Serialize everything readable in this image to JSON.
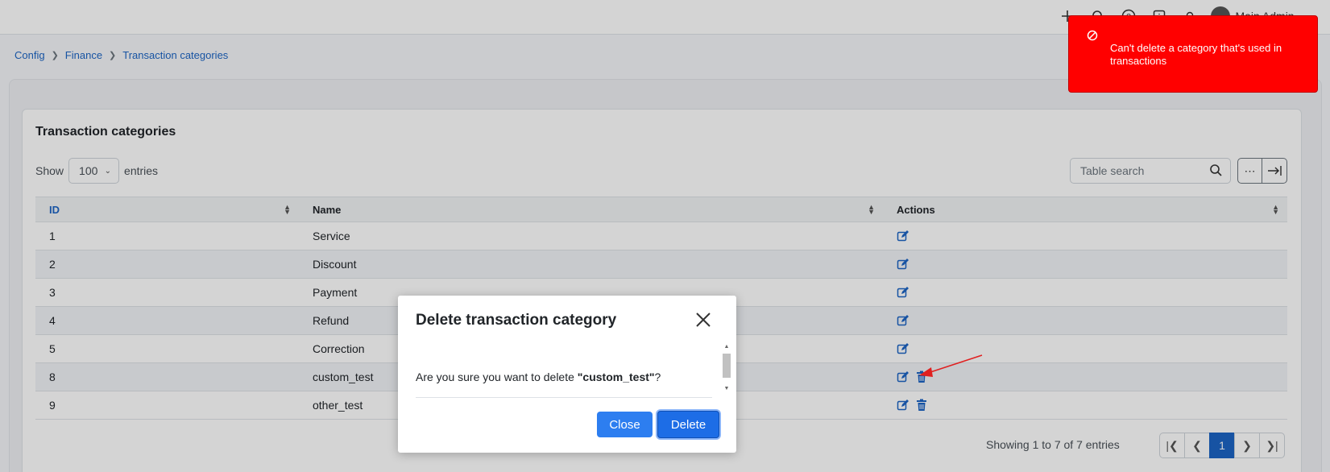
{
  "topbar": {
    "user_name": "Main Admin"
  },
  "breadcrumb": [
    "Config",
    "Finance",
    "Transaction categories"
  ],
  "card": {
    "title": "Transaction categories",
    "show_label": "Show",
    "entries_label": "entries",
    "page_size": "100",
    "search_placeholder": "Table search"
  },
  "table": {
    "headers": {
      "id": "ID",
      "name": "Name",
      "actions": "Actions"
    },
    "rows": [
      {
        "id": "1",
        "name": "Service",
        "deletable": false
      },
      {
        "id": "2",
        "name": "Discount",
        "deletable": false
      },
      {
        "id": "3",
        "name": "Payment",
        "deletable": false
      },
      {
        "id": "4",
        "name": "Refund",
        "deletable": false
      },
      {
        "id": "5",
        "name": "Correction",
        "deletable": false
      },
      {
        "id": "8",
        "name": "custom_test",
        "deletable": true
      },
      {
        "id": "9",
        "name": "other_test",
        "deletable": true
      }
    ]
  },
  "footer": {
    "info": "Showing 1 to 7 of 7 entries",
    "current_page": "1"
  },
  "modal": {
    "title": "Delete transaction category",
    "body_prefix": "Are you sure you want to delete ",
    "body_target": "\"custom_test\"",
    "body_suffix": "?",
    "close_label": "Close",
    "delete_label": "Delete"
  },
  "toast": {
    "message": "Can't delete a category that's used in transactions",
    "color": "#ff0000"
  },
  "colors": {
    "link": "#1c64c4",
    "primary_button": "#2d7ef0",
    "annotation_arrow": "#e02020"
  }
}
